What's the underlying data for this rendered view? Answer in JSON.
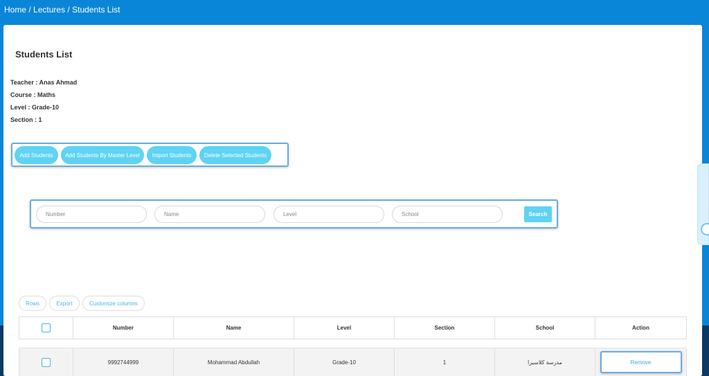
{
  "breadcrumb": {
    "home": "Home",
    "lectures": "Lectures",
    "current": "Students List",
    "separator": "/"
  },
  "page": {
    "title": "Students List"
  },
  "info": {
    "teacher": "Teacher : Anas Ahmad",
    "course": "Course : Maths",
    "level": "Level : Grade-10",
    "section": "Section : 1"
  },
  "actions": {
    "add_students": "Add Students",
    "add_by_master_level": "Add Students By Master Level",
    "import_students": "Import Students",
    "delete_selected": "Delete Selected Students"
  },
  "search": {
    "number_placeholder": "Number",
    "name_placeholder": "Name",
    "level_placeholder": "Level",
    "school_placeholder": "School",
    "button_label": "Search"
  },
  "table_tools": {
    "rows": "Rows",
    "export": "Export",
    "customize_columns": "Customize columns"
  },
  "table": {
    "columns": [
      "Number",
      "Name",
      "Level",
      "Section",
      "School",
      "Action"
    ],
    "rows": [
      {
        "number": "9992744999",
        "name": "Mohammad Abdullah",
        "level": "Grade-10",
        "section": "1",
        "school": "مدرسة كلاسيرا",
        "action": "Remove"
      }
    ]
  },
  "colors": {
    "top_bar": "#0a86d8",
    "accent": "#5fd3f3",
    "link": "#3aa9df"
  }
}
